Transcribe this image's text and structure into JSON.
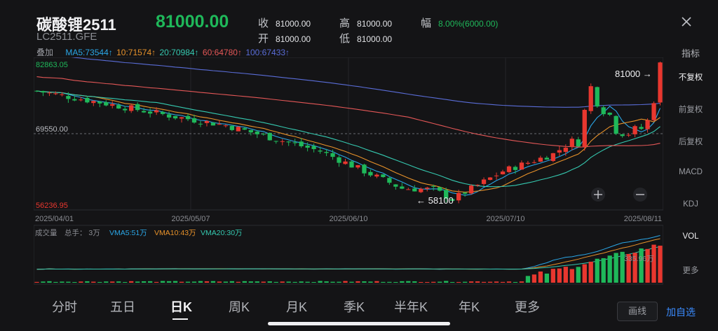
{
  "header": {
    "title": "碳酸锂2511",
    "code": "LC2511.GFE",
    "price": "81000.00",
    "stats": {
      "close_label": "收",
      "close": "81000.00",
      "open_label": "开",
      "open": "81000.00",
      "high_label": "高",
      "high": "81000.00",
      "low_label": "低",
      "low": "81000.00",
      "change_label": "幅",
      "change": "8.00%(6000.00)"
    }
  },
  "ma": {
    "overlay_label": "叠加",
    "ma5": "MA5:73544↑",
    "ma10": "10:71574↑",
    "ma20": "20:70984↑",
    "ma60": "60:64780↑",
    "ma100": "100:67433↑",
    "colors": {
      "ma5": "#2aa6e6",
      "ma10": "#e8922a",
      "ma20": "#35c9b0",
      "ma60": "#e45757",
      "ma100": "#5a6dd8"
    }
  },
  "right_panel": {
    "title": "指标",
    "items": [
      "不复权",
      "前复权",
      "后复权",
      "MACD",
      "KDJ",
      "VOL",
      "更多"
    ]
  },
  "chart": {
    "y_top": "82863.05",
    "y_mid": "69550.00",
    "y_bottom": "56236.95",
    "dates": [
      "2025/04/01",
      "2025/05/07",
      "2025/06/10",
      "2025/07/10",
      "2025/08/11"
    ],
    "high_marker": "81000",
    "low_marker": "58100",
    "colors": {
      "up": "#e8372f",
      "down": "#1fb85a"
    }
  },
  "volume": {
    "label": "成交量",
    "total": "总手： 3万",
    "vma5": "VMA5:51万",
    "vma10": "VMA10:43万",
    "vma20": "VMA20:30万",
    "axis_label": "335.96万"
  },
  "tabs": [
    "分时",
    "五日",
    "日K",
    "周K",
    "月K",
    "季K",
    "半年K",
    "年K",
    "更多"
  ],
  "buttons": {
    "draw": "画线",
    "add": "加自选"
  }
}
